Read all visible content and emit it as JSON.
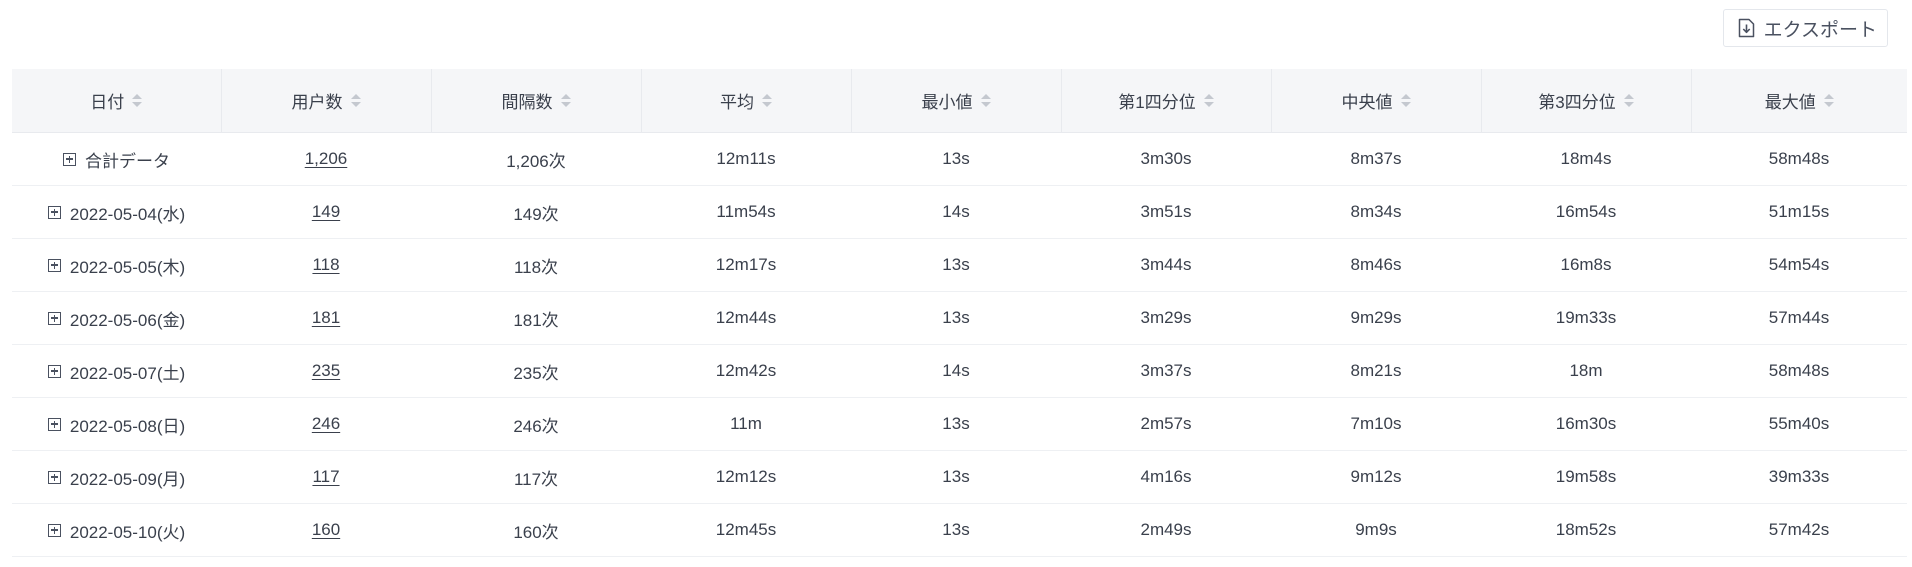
{
  "toolbar": {
    "export_label": "エクスポート",
    "export_icon": "download-file-icon"
  },
  "table": {
    "columns": [
      {
        "label": "日付"
      },
      {
        "label": "用户数"
      },
      {
        "label": "間隔数"
      },
      {
        "label": "平均"
      },
      {
        "label": "最小値"
      },
      {
        "label": "第1四分位"
      },
      {
        "label": "中央値"
      },
      {
        "label": "第3四分位"
      },
      {
        "label": "最大値"
      }
    ],
    "rows": [
      {
        "date": "合計データ",
        "users": "1,206",
        "intervals": "1,206次",
        "avg": "12m11s",
        "min": "13s",
        "q1": "3m30s",
        "median": "8m37s",
        "q3": "18m4s",
        "max": "58m48s"
      },
      {
        "date": "2022-05-04(水)",
        "users": "149",
        "intervals": "149次",
        "avg": "11m54s",
        "min": "14s",
        "q1": "3m51s",
        "median": "8m34s",
        "q3": "16m54s",
        "max": "51m15s"
      },
      {
        "date": "2022-05-05(木)",
        "users": "118",
        "intervals": "118次",
        "avg": "12m17s",
        "min": "13s",
        "q1": "3m44s",
        "median": "8m46s",
        "q3": "16m8s",
        "max": "54m54s"
      },
      {
        "date": "2022-05-06(金)",
        "users": "181",
        "intervals": "181次",
        "avg": "12m44s",
        "min": "13s",
        "q1": "3m29s",
        "median": "9m29s",
        "q3": "19m33s",
        "max": "57m44s"
      },
      {
        "date": "2022-05-07(土)",
        "users": "235",
        "intervals": "235次",
        "avg": "12m42s",
        "min": "14s",
        "q1": "3m37s",
        "median": "8m21s",
        "q3": "18m",
        "max": "58m48s"
      },
      {
        "date": "2022-05-08(日)",
        "users": "246",
        "intervals": "246次",
        "avg": "11m",
        "min": "13s",
        "q1": "2m57s",
        "median": "7m10s",
        "q3": "16m30s",
        "max": "55m40s"
      },
      {
        "date": "2022-05-09(月)",
        "users": "117",
        "intervals": "117次",
        "avg": "12m12s",
        "min": "13s",
        "q1": "4m16s",
        "median": "9m12s",
        "q3": "19m58s",
        "max": "39m33s"
      },
      {
        "date": "2022-05-10(火)",
        "users": "160",
        "intervals": "160次",
        "avg": "12m45s",
        "min": "13s",
        "q1": "2m49s",
        "median": "9m9s",
        "q3": "18m52s",
        "max": "57m42s"
      }
    ]
  }
}
